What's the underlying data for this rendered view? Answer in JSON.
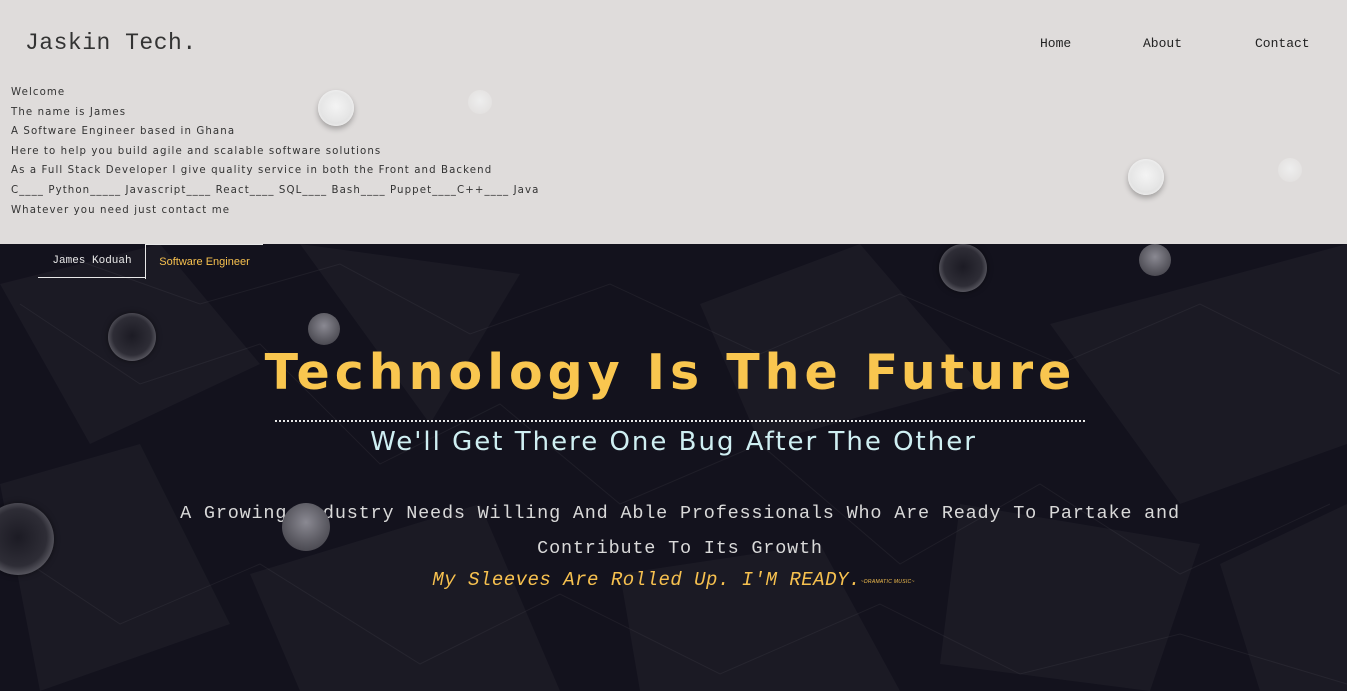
{
  "header": {
    "brand": "Jaskin Tech.",
    "nav": [
      "Home",
      "About",
      "Contact"
    ]
  },
  "intro": {
    "lines": [
      "Welcome",
      "The name is James",
      "A Software Engineer based in Ghana",
      "Here to help you build agile and scalable software solutions",
      "As a Full Stack Developer I give quality service in both the Front and Backend",
      "C____ Python_____ Javascript____ React____ SQL____ Bash____ Puppet____C++____ Java",
      "Whatever you need just contact me"
    ]
  },
  "hero": {
    "tabs": {
      "name": "James Koduah",
      "role": "Software Engineer"
    },
    "headline": "Technology Is The Future",
    "subheadline": "We'll Get There One Bug After The Other",
    "paragraph": "A Growing Industry Needs Willing And Able Professionals Who Are Ready To Partake and Contribute To Its Growth",
    "ready_line": "My Sleeves Are Rolled Up. I'M READY.",
    "ready_note": "~DRAMATIC MUSIC~"
  },
  "colors": {
    "header_bg": "#dfdcdb",
    "hero_bg": "#13121d",
    "accent_gold": "#f9c64f",
    "subheadline_cyan": "#cfeff2"
  }
}
